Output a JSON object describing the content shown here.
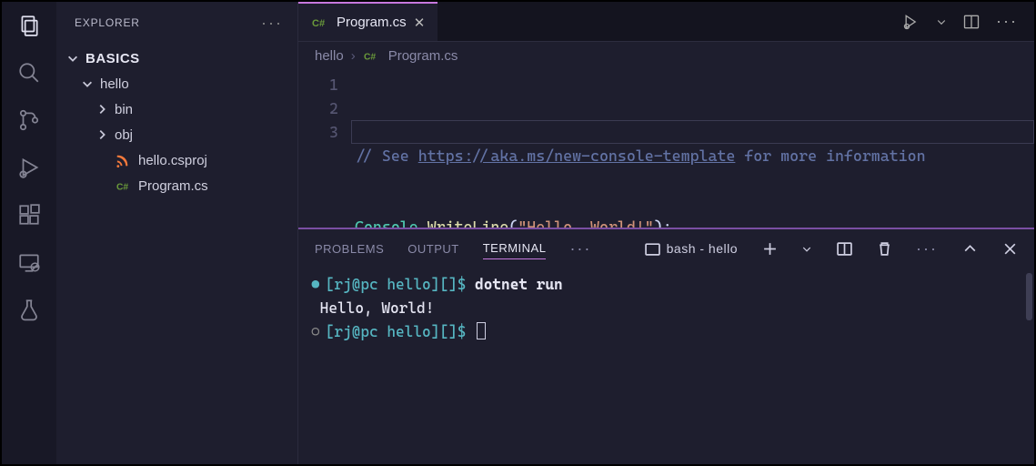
{
  "sidebar": {
    "title": "EXPLORER",
    "section": "BASICS",
    "tree": {
      "root": "hello",
      "folders": [
        "bin",
        "obj"
      ],
      "files": [
        {
          "name": "hello.csproj",
          "icon": "rss"
        },
        {
          "name": "Program.cs",
          "icon": "cs"
        }
      ]
    }
  },
  "tab": {
    "filename": "Program.cs"
  },
  "breadcrumbs": {
    "folder": "hello",
    "file": "Program.cs"
  },
  "editor": {
    "lineNumbers": [
      "1",
      "2",
      "3"
    ],
    "line1_comment_prefix": "// See ",
    "line1_url": "https://aka.ms/new-console-template",
    "line1_comment_suffix": " for more information",
    "line2_class": "Console",
    "line2_dot": ".",
    "line2_method": "WriteLine",
    "line2_open": "(",
    "line2_string": "\"Hello, World!\"",
    "line2_close": ");"
  },
  "panel": {
    "tabs": {
      "problems": "PROBLEMS",
      "output": "OUTPUT",
      "terminal": "TERMINAL"
    },
    "terminalTitle": "bash - hello"
  },
  "terminal": {
    "prompt1_user": "[rj@pc hello]",
    "prompt1_brackets": "[]",
    "prompt1_dollar": "$",
    "cmd1": "dotnet run",
    "output1": "Hello, World!",
    "prompt2_user": "[rj@pc hello]",
    "prompt2_brackets": "[]",
    "prompt2_dollar": "$"
  }
}
